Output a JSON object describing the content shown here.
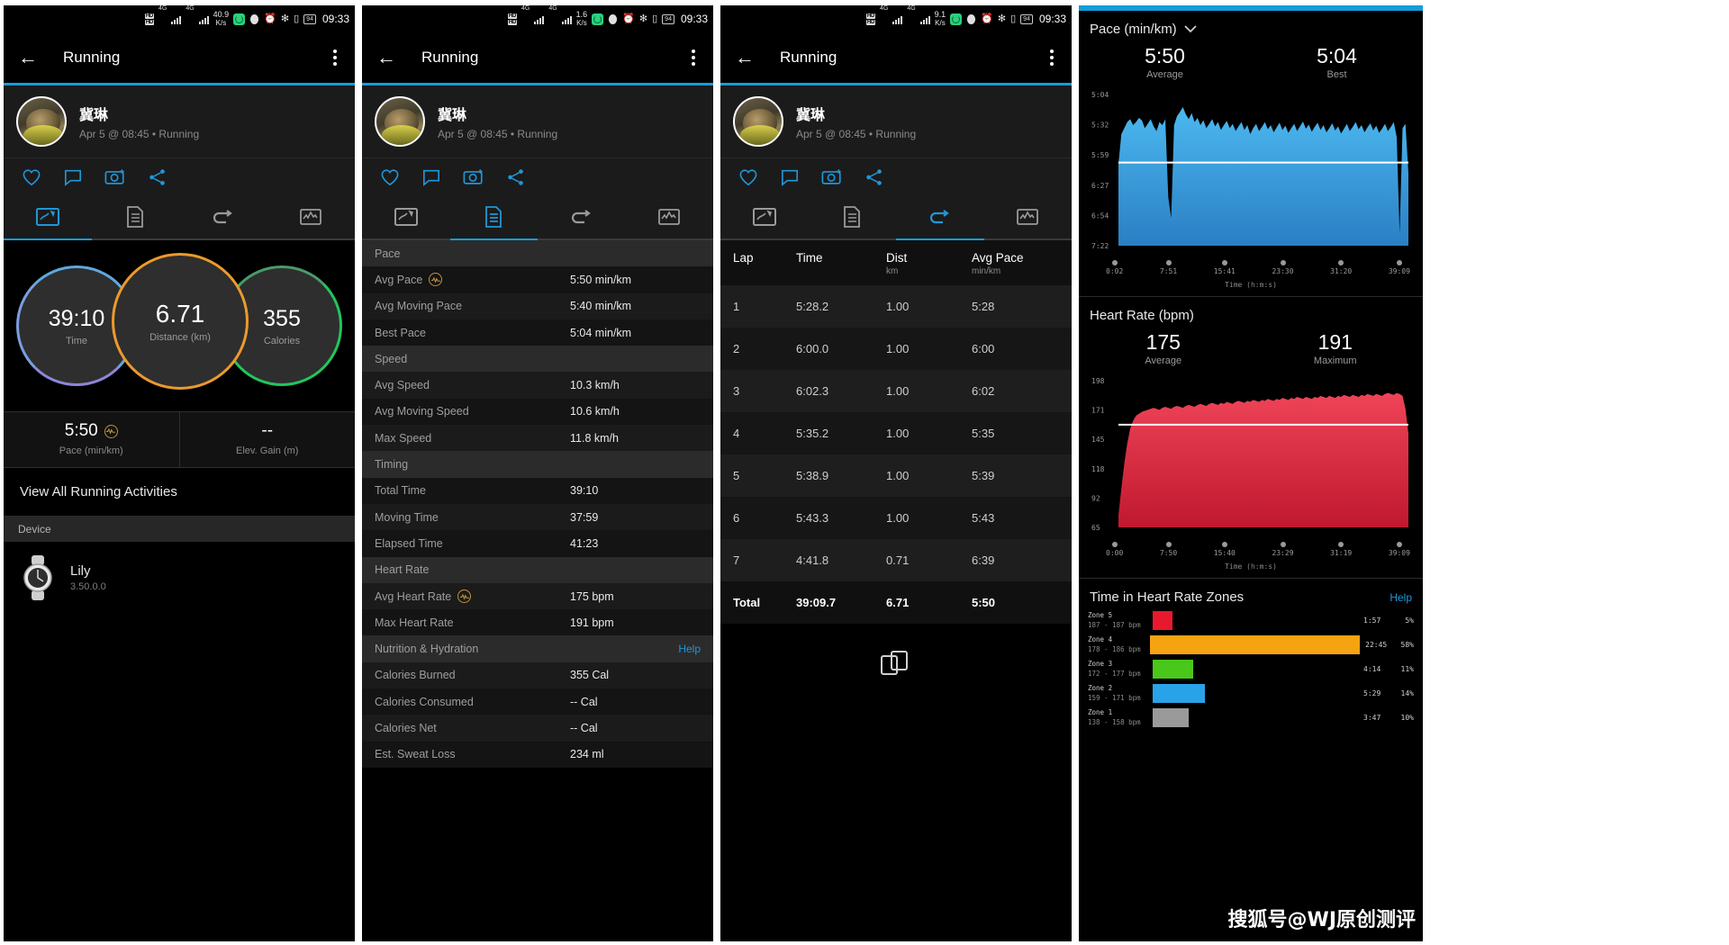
{
  "status_bar": {
    "hd1": "HD",
    "hd2": "HD",
    "net1": "4G",
    "net2": "4G",
    "rate_p1": "40.9",
    "rate_p2": "1.6",
    "rate_p3": "9.1",
    "rate_unit": "K/s",
    "battery": "94",
    "time": "09:33"
  },
  "appbar": {
    "title": "Running",
    "back_icon": "arrow-left-icon",
    "menu_icon": "overflow-menu-icon"
  },
  "profile": {
    "name": "冀琳",
    "subtitle": "Apr 5 @ 08:45 • Running"
  },
  "social": [
    "heart-icon",
    "comment-icon",
    "camera-icon",
    "share-icon"
  ],
  "tabs": [
    {
      "name": "tab-summary",
      "icon": "activity-summary-icon"
    },
    {
      "name": "tab-details",
      "icon": "details-list-icon"
    },
    {
      "name": "tab-laps",
      "icon": "laps-loop-icon"
    },
    {
      "name": "tab-charts",
      "icon": "charts-graph-icon"
    }
  ],
  "panel1": {
    "active_tab": 0,
    "rings": [
      {
        "value": "39:10",
        "label": "Time",
        "color": "#5fa8e0"
      },
      {
        "value": "6.71",
        "label": "Distance (km)",
        "color": "#eb9a2d"
      },
      {
        "value": "355",
        "label": "Calories",
        "color": "#22c55e"
      }
    ],
    "pace_value": "5:50",
    "pace_label": "Pace (min/km)",
    "elev_value": "--",
    "elev_label": "Elev. Gain (m)",
    "view_all": "View All Running Activities",
    "device_header": "Device",
    "device_name": "Lily",
    "device_version": "3.50.0.0"
  },
  "panel2": {
    "active_tab": 1,
    "sections": [
      {
        "header": "Pace",
        "rows": [
          {
            "key": "Avg Pace",
            "value": "5:50 min/km",
            "badge": true
          },
          {
            "key": "Avg Moving Pace",
            "value": "5:40 min/km",
            "badge": false
          },
          {
            "key": "Best Pace",
            "value": "5:04 min/km",
            "badge": false
          }
        ]
      },
      {
        "header": "Speed",
        "rows": [
          {
            "key": "Avg Speed",
            "value": "10.3 km/h",
            "badge": false
          },
          {
            "key": "Avg Moving Speed",
            "value": "10.6 km/h",
            "badge": false
          },
          {
            "key": "Max Speed",
            "value": "11.8 km/h",
            "badge": false
          }
        ]
      },
      {
        "header": "Timing",
        "rows": [
          {
            "key": "Total Time",
            "value": "39:10",
            "badge": false
          },
          {
            "key": "Moving Time",
            "value": "37:59",
            "badge": false
          },
          {
            "key": "Elapsed Time",
            "value": "41:23",
            "badge": false
          }
        ]
      },
      {
        "header": "Heart Rate",
        "rows": [
          {
            "key": "Avg Heart Rate",
            "value": "175 bpm",
            "badge": true
          },
          {
            "key": "Max Heart Rate",
            "value": "191 bpm",
            "badge": false
          }
        ]
      },
      {
        "header": "Nutrition & Hydration",
        "help": "Help",
        "rows": [
          {
            "key": "Calories Burned",
            "value": "355 Cal",
            "badge": false
          },
          {
            "key": "Calories Consumed",
            "value": "-- Cal",
            "badge": false
          },
          {
            "key": "Calories Net",
            "value": "-- Cal",
            "badge": false
          },
          {
            "key": "Est. Sweat Loss",
            "value": "234 ml",
            "badge": false
          }
        ]
      }
    ]
  },
  "panel3": {
    "active_tab": 2,
    "columns": [
      {
        "title": "Lap",
        "sub": ""
      },
      {
        "title": "Time",
        "sub": ""
      },
      {
        "title": "Dist",
        "sub": "km"
      },
      {
        "title": "Avg Pace",
        "sub": "min/km"
      }
    ],
    "rows": [
      {
        "lap": "1",
        "time": "5:28.2",
        "dist": "1.00",
        "pace": "5:28"
      },
      {
        "lap": "2",
        "time": "6:00.0",
        "dist": "1.00",
        "pace": "6:00"
      },
      {
        "lap": "3",
        "time": "6:02.3",
        "dist": "1.00",
        "pace": "6:02"
      },
      {
        "lap": "4",
        "time": "5:35.2",
        "dist": "1.00",
        "pace": "5:35"
      },
      {
        "lap": "5",
        "time": "5:38.9",
        "dist": "1.00",
        "pace": "5:39"
      },
      {
        "lap": "6",
        "time": "5:43.3",
        "dist": "1.00",
        "pace": "5:43"
      },
      {
        "lap": "7",
        "time": "4:41.8",
        "dist": "0.71",
        "pace": "6:39"
      }
    ],
    "total": {
      "lap": "Total",
      "time": "39:09.7",
      "dist": "6.71",
      "pace": "5:50"
    },
    "split_icon": "split-compare-icon"
  },
  "panel4": {
    "pace_chart": {
      "title": "Pace (min/km)",
      "dropdown_icon": "chevron-down-icon",
      "average_value": "5:50",
      "average_label": "Average",
      "best_value": "5:04",
      "best_label": "Best"
    },
    "hr_chart": {
      "title": "Heart Rate (bpm)",
      "average_value": "175",
      "average_label": "Average",
      "max_value": "191",
      "max_label": "Maximum"
    },
    "zones": {
      "title": "Time in Heart Rate Zones",
      "help": "Help"
    },
    "watermark": "搜狐号@WJ原创测评"
  },
  "chart_data": [
    {
      "type": "area",
      "title": "Pace (min/km)",
      "xlabel": "Time (h:m:s)",
      "ylabel": "Pace (min/km)",
      "yticks": [
        "5:04",
        "5:32",
        "5:59",
        "6:27",
        "6:54",
        "7:22"
      ],
      "xticks": [
        "0:02",
        "7:51",
        "15:41",
        "23:30",
        "31:20",
        "39:09"
      ],
      "average_line": "5:50",
      "color_top": "#4cb8ef",
      "color_bottom": "#2a7fc4",
      "values": [
        6.05,
        5.55,
        5.45,
        5.35,
        5.3,
        5.4,
        5.35,
        5.28,
        5.32,
        5.45,
        5.38,
        5.3,
        5.42,
        5.5,
        5.35,
        5.4,
        5.3,
        6.6,
        6.95,
        5.4,
        5.25,
        5.18,
        5.1,
        5.22,
        5.3,
        5.2,
        5.35,
        5.28,
        5.4,
        5.32,
        5.45,
        5.38,
        5.3,
        5.42,
        5.35,
        5.48,
        5.4,
        5.33,
        5.45,
        5.38,
        5.5,
        5.42,
        5.35,
        5.48,
        5.4,
        5.55,
        5.45,
        5.38,
        5.5,
        5.43,
        5.35,
        5.47,
        5.4,
        5.52,
        5.44,
        5.36,
        5.48,
        5.41,
        5.53,
        5.45,
        5.38,
        5.5,
        5.42,
        5.34,
        5.46,
        5.39,
        5.51,
        5.43,
        5.36,
        5.48,
        5.4,
        5.52,
        5.45,
        5.37,
        5.49,
        5.42,
        5.54,
        5.46,
        5.38,
        5.5,
        5.43,
        5.35,
        5.47,
        5.4,
        5.52,
        5.44,
        5.37,
        5.49,
        5.41,
        5.53,
        5.46,
        5.38,
        5.5,
        5.43,
        5.35,
        5.6,
        7.2,
        5.45,
        5.38,
        6.2
      ]
    },
    {
      "type": "area",
      "title": "Heart Rate (bpm)",
      "xlabel": "Time (h:m:s)",
      "ylabel": "Heart Rate (bpm)",
      "yticks": [
        "198",
        "171",
        "145",
        "118",
        "92",
        "65"
      ],
      "xticks": [
        "0:00",
        "7:50",
        "15:40",
        "23:29",
        "31:19",
        "39:09"
      ],
      "average_line": "175",
      "color_top": "#ef4458",
      "color_bottom": "#c0182f",
      "values": [
        68,
        95,
        120,
        140,
        155,
        163,
        168,
        170,
        172,
        173,
        174,
        175,
        176,
        175,
        174,
        176,
        177,
        176,
        175,
        177,
        178,
        177,
        176,
        178,
        179,
        178,
        177,
        179,
        180,
        179,
        178,
        180,
        181,
        180,
        179,
        181,
        180,
        182,
        181,
        180,
        182,
        183,
        182,
        181,
        183,
        182,
        184,
        183,
        182,
        184,
        183,
        185,
        184,
        183,
        185,
        184,
        186,
        185,
        184,
        186,
        185,
        187,
        186,
        185,
        187,
        186,
        185,
        187,
        186,
        188,
        187,
        186,
        188,
        187,
        186,
        188,
        187,
        189,
        188,
        187,
        189,
        188,
        187,
        189,
        188,
        190,
        189,
        188,
        190,
        189,
        188,
        190,
        191,
        190,
        189,
        191,
        190,
        188,
        175,
        150
      ]
    },
    {
      "type": "bar",
      "title": "Time in Heart Rate Zones",
      "orientation": "horizontal",
      "categories": [
        "Zone 5",
        "Zone 4",
        "Zone 3",
        "Zone 2",
        "Zone 1"
      ],
      "zone_ranges": [
        "187 - 187 bpm",
        "178 - 186 bpm",
        "172 - 177 bpm",
        "159 - 171 bpm",
        "138 - 158 bpm"
      ],
      "time_labels": [
        "1:57",
        "22:45",
        "4:14",
        "5:29",
        "3:47"
      ],
      "pct_labels": [
        "5%",
        "58%",
        "11%",
        "14%",
        "10%"
      ],
      "values": [
        1.95,
        22.75,
        4.23,
        5.48,
        3.78
      ],
      "colors": [
        "#e8192c",
        "#f5a310",
        "#4ac71b",
        "#29a3e8",
        "#9a9a9a"
      ],
      "max_value": 22.75
    }
  ]
}
